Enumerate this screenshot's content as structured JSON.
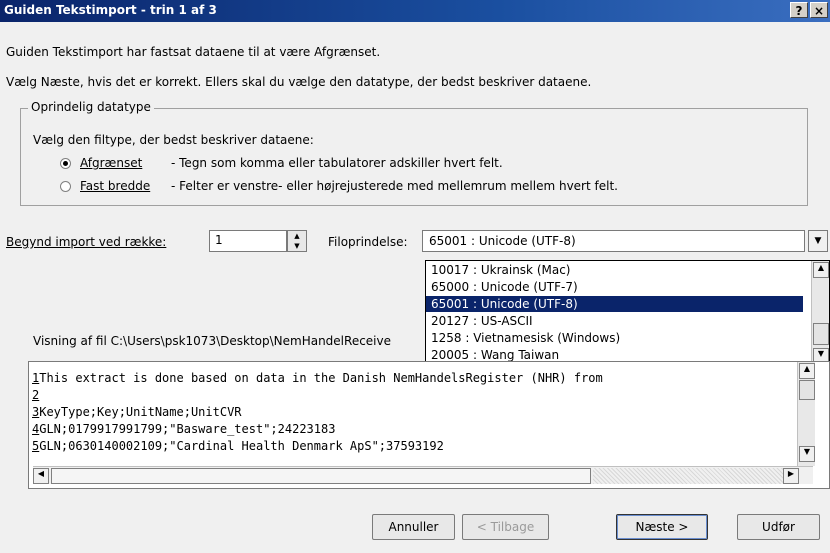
{
  "window": {
    "title": "Guiden Tekstimport - trin 1 af 3",
    "help_label": "?",
    "close_label": "×"
  },
  "intro": {
    "line1": "Guiden Tekstimport har fastsat dataene til at være Afgrænset.",
    "line2": "Vælg Næste, hvis det er korrekt. Ellers skal du vælge den datatype, der bedst beskriver dataene."
  },
  "datatype_group": {
    "legend": "Oprindelig datatype",
    "prompt": "Vælg den filtype, der bedst beskriver dataene:",
    "options": [
      {
        "label": "Afgrænset",
        "description": "- Tegn som komma eller tabulatorer adskiller hvert felt.",
        "checked": true
      },
      {
        "label": "Fast bredde",
        "description": "- Felter er venstre- eller højrejusterede med mellemrum mellem hvert felt.",
        "checked": false
      }
    ]
  },
  "import_row": {
    "label": "Begynd import ved række:",
    "value": "1"
  },
  "file_origin": {
    "label": "Filoprindelse:",
    "selected": "65001 : Unicode (UTF-8)",
    "options": [
      "10017 : Ukrainsk (Mac)",
      "65000 : Unicode (UTF-7)",
      "65001 : Unicode (UTF-8)",
      "20127 : US-ASCII",
      " 1258 : Vietnamesisk (Windows)",
      "20005 : Wang Taiwan"
    ],
    "selected_index": 2
  },
  "preview": {
    "label": "Visning af fil C:\\Users\\psk1073\\Desktop\\NemHandelReceive",
    "lines": [
      {
        "num": "1",
        "text": "This extract is done based on data in the Danish NemHandelsRegister (NHR) from"
      },
      {
        "num": "2",
        "text": ""
      },
      {
        "num": "3",
        "text": "KeyType;Key;UnitName;UnitCVR"
      },
      {
        "num": "4",
        "text": "GLN;0179917991799;\"Basware_test\";24223183"
      },
      {
        "num": "5",
        "text": "GLN;0630140002109;\"Cardinal Health Denmark ApS\";37593192"
      }
    ]
  },
  "buttons": {
    "cancel": "Annuller",
    "back": "< Tilbage",
    "next": "Næste >",
    "finish": "Udfør"
  }
}
